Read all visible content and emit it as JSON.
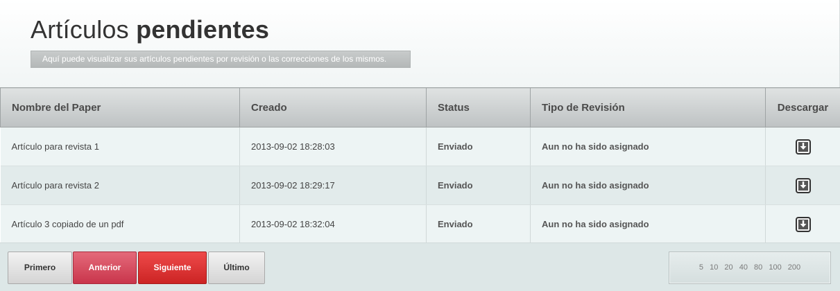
{
  "header": {
    "title_light": "Artículos",
    "title_bold": "pendientes",
    "subtitle": "Aquí puede visualizar sus artículos pendientes por revisión o las correcciones de los mismos."
  },
  "table": {
    "columns": [
      "Nombre del Paper",
      "Creado",
      "Status",
      "Tipo de Revisión",
      "Descargar"
    ],
    "rows": [
      {
        "name": "Artículo para revista 1",
        "created": "2013-09-02 18:28:03",
        "status": "Enviado",
        "review_type": "Aun no ha sido asignado",
        "download_icon": "download-icon"
      },
      {
        "name": "Artículo para revista 2",
        "created": "2013-09-02 18:29:17",
        "status": "Enviado",
        "review_type": "Aun no ha sido asignado",
        "download_icon": "download-icon"
      },
      {
        "name": "Artículo 3 copiado de un pdf",
        "created": "2013-09-02 18:32:04",
        "status": "Enviado",
        "review_type": "Aun no ha sido asignado",
        "download_icon": "download-icon"
      }
    ]
  },
  "pagination": {
    "first": "Primero",
    "previous": "Anterior",
    "next": "Siguiente",
    "last": "Último",
    "page_sizes": [
      "5",
      "10",
      "20",
      "40",
      "80",
      "100",
      "200"
    ]
  },
  "colors": {
    "previous_button": "#c9354b",
    "next_button": "#cc2424",
    "row_odd": "#edf4f4",
    "row_even": "#e2ebeb"
  }
}
